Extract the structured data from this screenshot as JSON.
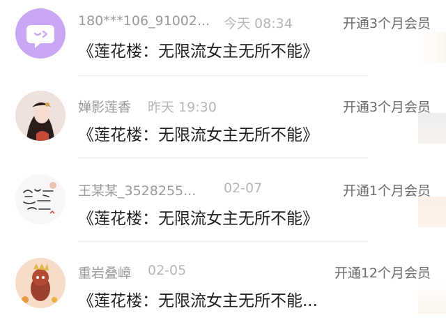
{
  "messages": [
    {
      "username": "180***106_91002...",
      "time": "今天 08:34",
      "badge": "开通3个月会员",
      "content": "《莲花楼：无限流女主无所不能》",
      "avatar": "chat-bubble-icon"
    },
    {
      "username": "婵影莲香",
      "time": "昨天 19:30",
      "badge": "开通3个月会员",
      "content": "《莲花楼：无限流女主无所不能》",
      "avatar": "user-photo"
    },
    {
      "username": "王某某_3528255...",
      "time": "02-07",
      "badge": "开通1个月会员",
      "content": "《莲花楼：无限流女主无所不能》",
      "avatar": "handwriting-sticker"
    },
    {
      "username": "重岩叠嶂",
      "time": "02-05",
      "badge": "开通12个月会员",
      "content": "《莲花楼：无限流女主无所不能...",
      "avatar": "cartoon-character"
    }
  ],
  "colors": {
    "avatar_purple": "#c9a7f5",
    "text_primary": "#1f1f1f",
    "text_secondary": "#9a9a9a"
  }
}
